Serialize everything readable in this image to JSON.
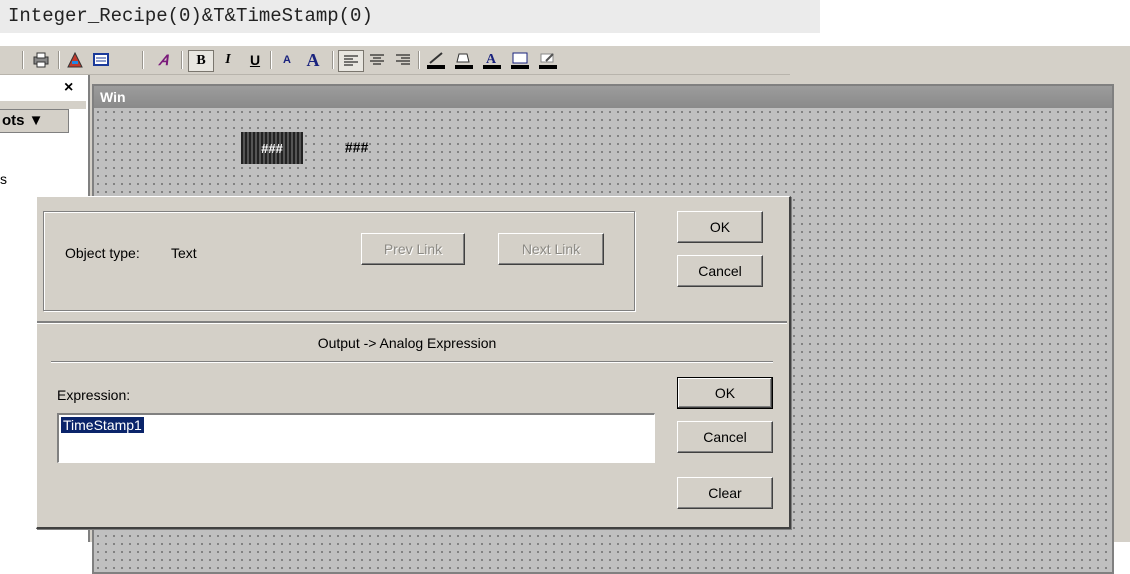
{
  "code_line": "Integer_Recipe(0)&T&TimeStamp(0)",
  "toolbar": {
    "icons": [
      "print-icon",
      "wizard-icon",
      "screen-icon",
      "font-icon",
      "bold-icon",
      "italic-icon",
      "underline-icon",
      "font-smaller-icon",
      "font-larger-icon",
      "align-left-icon",
      "align-center-icon",
      "align-right-icon",
      "line-color-icon",
      "fill-color-icon",
      "font-color-icon",
      "background-icon",
      "pen-icon"
    ],
    "bold": "B",
    "italic": "I",
    "underline": "U",
    "font_small": "A",
    "font_large": "A"
  },
  "left_panel": {
    "close": "×",
    "tab_label": "ots ▼",
    "item_label": "s"
  },
  "window": {
    "title": "Win",
    "hash_box_text": "###",
    "hash_text": "###"
  },
  "dialog": {
    "object_type_label": "Object type:",
    "object_type_value": "Text",
    "prev_link": "Prev Link",
    "next_link": "Next Link",
    "ok_top": "OK",
    "cancel_top": "Cancel",
    "section_title": "Output -> Analog Expression",
    "expression_label": "Expression:",
    "expression_value": "TimeStamp1",
    "ok": "OK",
    "cancel": "Cancel",
    "clear": "Clear"
  },
  "colors": {
    "face": "#d4d0c8",
    "selection": "#0a246a",
    "titlebar": "#8a8a8a"
  }
}
